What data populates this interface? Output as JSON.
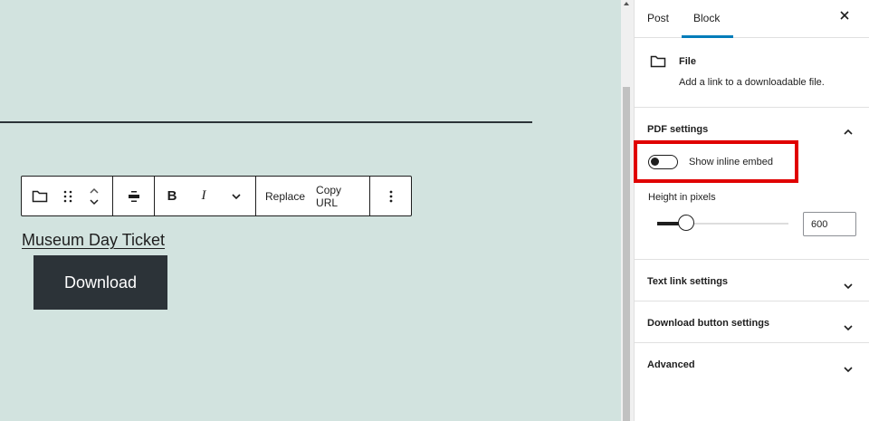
{
  "canvas": {
    "toolbar": {
      "replace_label": "Replace",
      "copy_url_label": "Copy URL",
      "bold_label": "B",
      "italic_label": "I"
    },
    "file_link_text": "Museum Day Ticket",
    "download_button_label": "Download"
  },
  "sidebar": {
    "tabs": [
      {
        "label": "Post"
      },
      {
        "label": "Block",
        "active": true
      }
    ],
    "close_icon": "close-icon",
    "block": {
      "title": "File",
      "description": "Add a link to a downloadable file."
    },
    "pdf_settings": {
      "title": "PDF settings",
      "toggle_label": "Show inline embed",
      "toggle_on": false,
      "height_label": "Height in pixels",
      "height_value": "600",
      "slider_fraction": 0.22
    },
    "panels": [
      {
        "title": "Text link settings"
      },
      {
        "title": "Download button settings"
      },
      {
        "title": "Advanced"
      }
    ]
  },
  "colors": {
    "canvas_bg": "#d2e3df",
    "accent": "#007cba",
    "highlight": "#e00000",
    "button_bg": "#2c3338"
  }
}
